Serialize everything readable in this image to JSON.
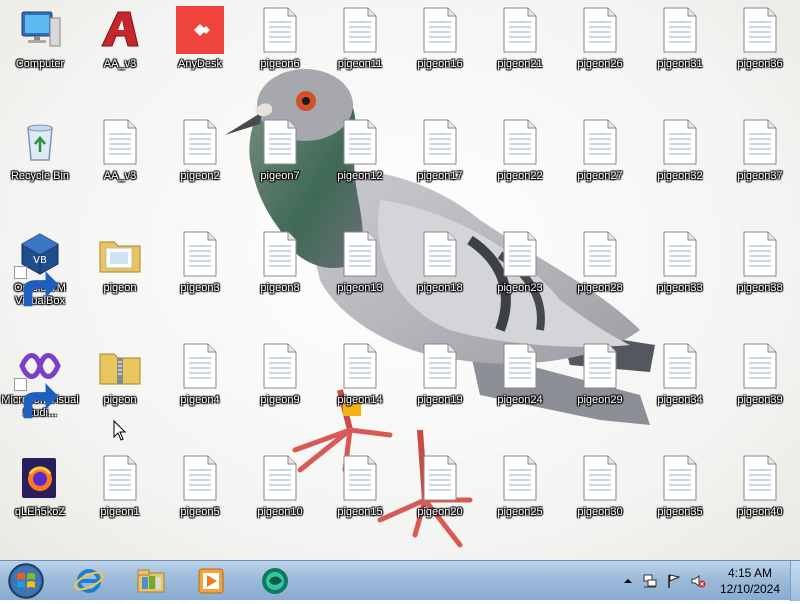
{
  "desktop": {
    "icons": [
      {
        "label": "Computer",
        "kind": "computer"
      },
      {
        "label": "Recycle Bin",
        "kind": "recycle"
      },
      {
        "label": "Oracle VM VirtualBox",
        "kind": "virtualbox",
        "shortcut": true
      },
      {
        "label": "Microsoft Visual Studi...",
        "kind": "vs",
        "shortcut": true
      },
      {
        "label": "qLEh5koZ",
        "kind": "firefox"
      },
      {
        "label": "AA_v3",
        "kind": "aa"
      },
      {
        "label": "AA_v3",
        "kind": "file"
      },
      {
        "label": "pigeon",
        "kind": "folder"
      },
      {
        "label": "pigeon",
        "kind": "zip"
      },
      {
        "label": "pigeon1",
        "kind": "file"
      },
      {
        "label": "AnyDesk",
        "kind": "anydesk"
      },
      {
        "label": "pigeon2",
        "kind": "file"
      },
      {
        "label": "pigeon3",
        "kind": "file"
      },
      {
        "label": "pigeon4",
        "kind": "file"
      },
      {
        "label": "pigeon5",
        "kind": "file"
      },
      {
        "label": "pigeon6",
        "kind": "file"
      },
      {
        "label": "pigeon7",
        "kind": "file"
      },
      {
        "label": "pigeon8",
        "kind": "file"
      },
      {
        "label": "pigeon9",
        "kind": "file"
      },
      {
        "label": "pigeon10",
        "kind": "file"
      },
      {
        "label": "pigeon11",
        "kind": "file"
      },
      {
        "label": "pigeon12",
        "kind": "file"
      },
      {
        "label": "pigeon13",
        "kind": "file"
      },
      {
        "label": "pigeon14",
        "kind": "file"
      },
      {
        "label": "pigeon15",
        "kind": "file"
      },
      {
        "label": "pigeon16",
        "kind": "file"
      },
      {
        "label": "pigeon17",
        "kind": "file"
      },
      {
        "label": "pigeon18",
        "kind": "file"
      },
      {
        "label": "pigeon19",
        "kind": "file"
      },
      {
        "label": "pigeon20",
        "kind": "file"
      },
      {
        "label": "pigeon21",
        "kind": "file"
      },
      {
        "label": "pigeon22",
        "kind": "file"
      },
      {
        "label": "pigeon23",
        "kind": "file"
      },
      {
        "label": "pigeon24",
        "kind": "file"
      },
      {
        "label": "pigeon25",
        "kind": "file"
      },
      {
        "label": "pigeon26",
        "kind": "file"
      },
      {
        "label": "pigeon27",
        "kind": "file"
      },
      {
        "label": "pigeon28",
        "kind": "file"
      },
      {
        "label": "pigeon29",
        "kind": "file"
      },
      {
        "label": "pigeon30",
        "kind": "file"
      },
      {
        "label": "pigeon31",
        "kind": "file"
      },
      {
        "label": "pigeon32",
        "kind": "file"
      },
      {
        "label": "pigeon33",
        "kind": "file"
      },
      {
        "label": "pigeon34",
        "kind": "file"
      },
      {
        "label": "pigeon35",
        "kind": "file"
      },
      {
        "label": "pigeon36",
        "kind": "file"
      },
      {
        "label": "pigeon37",
        "kind": "file"
      },
      {
        "label": "pigeon38",
        "kind": "file"
      },
      {
        "label": "pigeon39",
        "kind": "file"
      },
      {
        "label": "pigeon40",
        "kind": "file"
      }
    ]
  },
  "taskbar": {
    "start_icon": "windows-start-icon",
    "pinned": [
      {
        "name": "internet-explorer",
        "icon": "internet-explorer-icon"
      },
      {
        "name": "windows-explorer",
        "icon": "folder-library-icon"
      },
      {
        "name": "media-player",
        "icon": "media-player-icon"
      },
      {
        "name": "app-green",
        "icon": "green-app-icon"
      }
    ],
    "tray": {
      "time": "4:15 AM",
      "date": "12/10/2024",
      "icons": [
        "show-hidden-icons-arrow",
        "network-icon",
        "action-center-flag-icon",
        "volume-muted-icon"
      ]
    }
  },
  "colors": {
    "anydesk_red": "#ef443b",
    "taskbar_top": "#bcd3ea",
    "taskbar_bottom": "#88acd1"
  }
}
